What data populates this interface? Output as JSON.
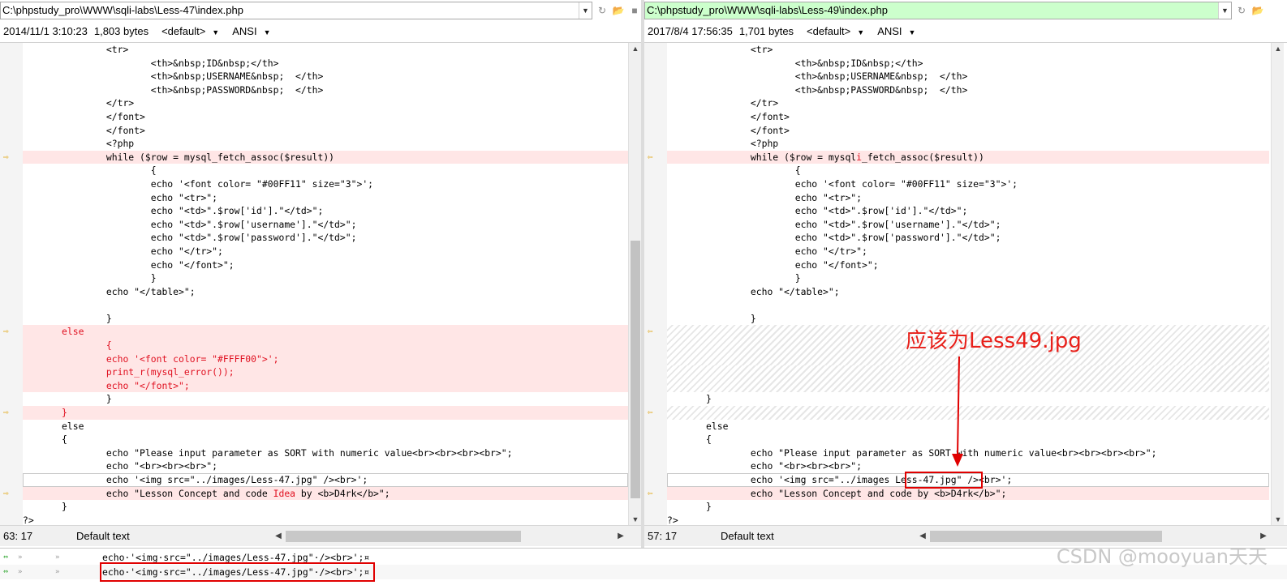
{
  "left": {
    "path": "C:\\phpstudy_pro\\WWW\\sqli-labs\\Less-47\\index.php",
    "date": "2014/11/1 3:10:23",
    "size": "1,803 bytes",
    "syntax": "<default>",
    "encoding": "ANSI",
    "cursor": "63: 17",
    "text_type": "Default text",
    "lines": [
      {
        "kind": "normal",
        "text": "               <tr>"
      },
      {
        "kind": "normal",
        "text": "                       <th>&nbsp;ID&nbsp;</th>"
      },
      {
        "kind": "normal",
        "text": "                       <th>&nbsp;USERNAME&nbsp;  </th>"
      },
      {
        "kind": "normal",
        "text": "                       <th>&nbsp;PASSWORD&nbsp;  </th>"
      },
      {
        "kind": "normal",
        "text": "               </tr>"
      },
      {
        "kind": "normal",
        "text": "               </font>"
      },
      {
        "kind": "normal",
        "text": "               </font>"
      },
      {
        "kind": "normal",
        "text": "               <?php"
      },
      {
        "kind": "diff",
        "marker": true,
        "text": "               while ($row = mysql_fetch_assoc($result))"
      },
      {
        "kind": "normal",
        "text": "                       {"
      },
      {
        "kind": "normal",
        "text": "                       echo '<font color= \"#00FF11\" size=\"3\">';"
      },
      {
        "kind": "normal",
        "text": "                       echo \"<tr>\";"
      },
      {
        "kind": "normal",
        "text": "                       echo \"<td>\".$row['id'].\"</td>\";"
      },
      {
        "kind": "normal",
        "text": "                       echo \"<td>\".$row['username'].\"</td>\";"
      },
      {
        "kind": "normal",
        "text": "                       echo \"<td>\".$row['password'].\"</td>\";"
      },
      {
        "kind": "normal",
        "text": "                       echo \"</tr>\";"
      },
      {
        "kind": "normal",
        "text": "                       echo \"</font>\";"
      },
      {
        "kind": "normal",
        "text": "                       }"
      },
      {
        "kind": "normal",
        "text": "               echo \"</table>\";"
      },
      {
        "kind": "normal",
        "text": ""
      },
      {
        "kind": "normal",
        "text": "               }"
      },
      {
        "kind": "diffred",
        "marker": true,
        "text": "       else"
      },
      {
        "kind": "diffred",
        "text": "               {"
      },
      {
        "kind": "diffred",
        "text": "               echo '<font color= \"#FFFF00\">';"
      },
      {
        "kind": "diffred",
        "text": "               print_r(mysql_error());"
      },
      {
        "kind": "diffred",
        "text": "               echo \"</font>\";"
      },
      {
        "kind": "normal",
        "text": "               }"
      },
      {
        "kind": "diffred",
        "marker": true,
        "text": "       }"
      },
      {
        "kind": "normal",
        "text": "       else"
      },
      {
        "kind": "normal",
        "text": "       {"
      },
      {
        "kind": "normal",
        "text": "               echo \"Please input parameter as SORT with numeric value<br><br><br><br>\";"
      },
      {
        "kind": "normal",
        "text": "               echo \"<br><br><br>\";"
      },
      {
        "kind": "current",
        "text": "               echo '<img src=\"../images/Less-47.jpg\" /><br>';"
      },
      {
        "kind": "diff",
        "marker": true,
        "pre": "               echo \"Lesson Concept and code ",
        "hl": "Idea",
        "post": " by <b>D4rk</b>\";"
      },
      {
        "kind": "normal",
        "text": "       }"
      },
      {
        "kind": "normal",
        "text": "?>"
      }
    ]
  },
  "right": {
    "path": "C:\\phpstudy_pro\\WWW\\sqli-labs\\Less-49\\index.php",
    "date": "2017/8/4 17:56:35",
    "size": "1,701 bytes",
    "syntax": "<default>",
    "encoding": "ANSI",
    "cursor": "57: 17",
    "text_type": "Default text",
    "lines": [
      {
        "kind": "normal",
        "text": "               <tr>"
      },
      {
        "kind": "normal",
        "text": "                       <th>&nbsp;ID&nbsp;</th>"
      },
      {
        "kind": "normal",
        "text": "                       <th>&nbsp;USERNAME&nbsp;  </th>"
      },
      {
        "kind": "normal",
        "text": "                       <th>&nbsp;PASSWORD&nbsp;  </th>"
      },
      {
        "kind": "normal",
        "text": "               </tr>"
      },
      {
        "kind": "normal",
        "text": "               </font>"
      },
      {
        "kind": "normal",
        "text": "               </font>"
      },
      {
        "kind": "normal",
        "text": "               <?php"
      },
      {
        "kind": "diff",
        "marker": true,
        "pre": "               while ($row = mysql",
        "hl": "i",
        "post": "_fetch_assoc($result))"
      },
      {
        "kind": "normal",
        "text": "                       {"
      },
      {
        "kind": "normal",
        "text": "                       echo '<font color= \"#00FF11\" size=\"3\">';"
      },
      {
        "kind": "normal",
        "text": "                       echo \"<tr>\";"
      },
      {
        "kind": "normal",
        "text": "                       echo \"<td>\".$row['id'].\"</td>\";"
      },
      {
        "kind": "normal",
        "text": "                       echo \"<td>\".$row['username'].\"</td>\";"
      },
      {
        "kind": "normal",
        "text": "                       echo \"<td>\".$row['password'].\"</td>\";"
      },
      {
        "kind": "normal",
        "text": "                       echo \"</tr>\";"
      },
      {
        "kind": "normal",
        "text": "                       echo \"</font>\";"
      },
      {
        "kind": "normal",
        "text": "                       }"
      },
      {
        "kind": "normal",
        "text": "               echo \"</table>\";"
      },
      {
        "kind": "normal",
        "text": ""
      },
      {
        "kind": "normal",
        "text": "               }"
      },
      {
        "kind": "hatch",
        "marker": true,
        "text": ""
      },
      {
        "kind": "hatch",
        "text": ""
      },
      {
        "kind": "hatch",
        "text": ""
      },
      {
        "kind": "hatch",
        "text": ""
      },
      {
        "kind": "hatch",
        "text": ""
      },
      {
        "kind": "normal",
        "text": "       }"
      },
      {
        "kind": "hatch",
        "marker": true,
        "text": ""
      },
      {
        "kind": "normal",
        "text": "       else"
      },
      {
        "kind": "normal",
        "text": "       {"
      },
      {
        "kind": "normal",
        "text": "               echo \"Please input parameter as SORT with numeric value<br><br><br><br>\";"
      },
      {
        "kind": "normal",
        "text": "               echo \"<br><br><br>\";"
      },
      {
        "kind": "current",
        "text": "               echo '<img src=\"../images Less-47.jpg\" /><br>';"
      },
      {
        "kind": "diff",
        "marker": true,
        "text": "               echo \"Lesson Concept and code by <b>D4rk</b>\";"
      },
      {
        "kind": "normal",
        "text": "       }"
      },
      {
        "kind": "normal",
        "text": "?>"
      }
    ]
  },
  "compare": {
    "line1": "echo·'<img·src=\"../images/Less-47.jpg\"·/><br>';¤",
    "line2": "echo·'<img·src=\"../images/Less-47.jpg\"·/><br>';¤"
  },
  "annotation": {
    "text": "应该为Less49.jpg"
  },
  "watermark": "CSDN @mooyuan天天",
  "colors": {
    "diff_bg": "#ffe6e6",
    "diff_text": "#e01020",
    "annotation_red": "#e8201a",
    "path_changed": "#ccffcc"
  }
}
